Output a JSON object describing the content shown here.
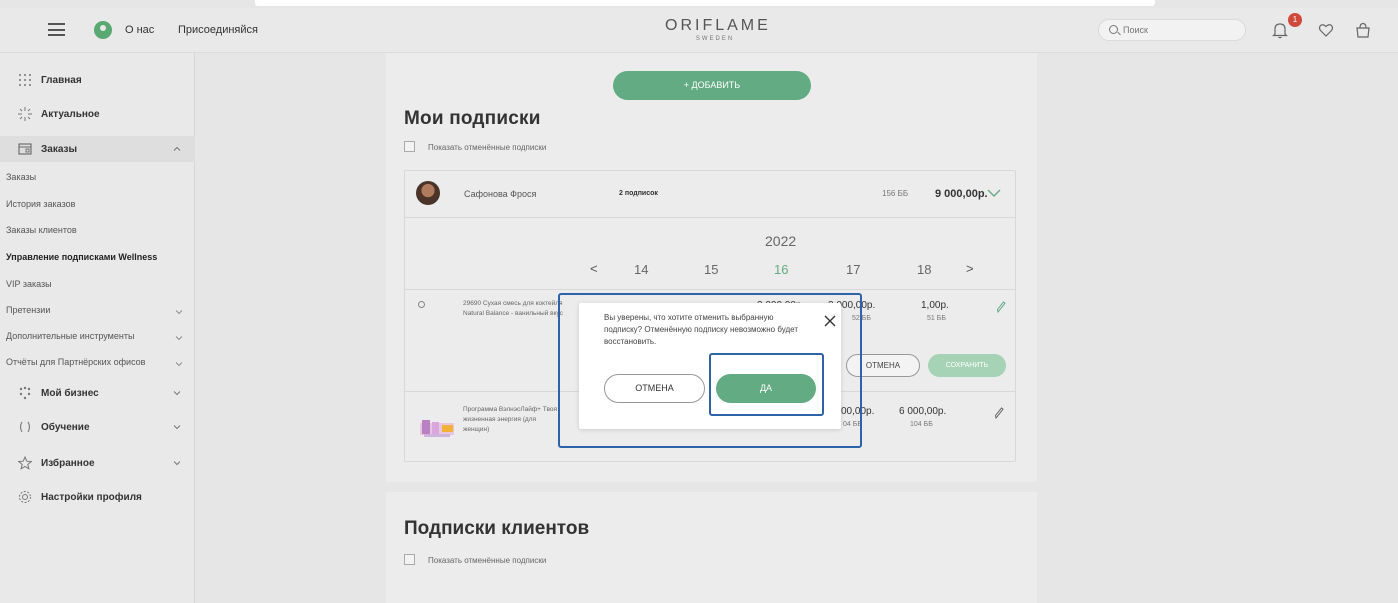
{
  "header": {
    "about_label": "О нас",
    "join_label": "Присоединяйся",
    "logo_main": "ORIFLAME",
    "logo_sub": "SWEDEN",
    "search_placeholder": "Поиск",
    "notification_count": "1"
  },
  "sidebar": {
    "home": "Главная",
    "news": "Актуальное",
    "orders": "Заказы",
    "orders_sub": {
      "orders": "Заказы",
      "history": "История заказов",
      "client_orders": "Заказы клиентов",
      "wellness": "Управление подписками Wellness",
      "vip": "VIP заказы",
      "claims": "Претензии",
      "tools": "Дополнительные инструменты",
      "reports": "Отчёты для Партнёрских офисов"
    },
    "business": "Мой бизнес",
    "learning": "Обучение",
    "favorites": "Избранное",
    "profile": "Настройки профиля"
  },
  "main": {
    "add_button": "+ ДОБАВИТЬ",
    "my_subs_title": "Мои подписки",
    "show_cancelled": "Показать отменённые подписки",
    "subscription": {
      "name": "Сафонова Фрося",
      "count": "2 подписок",
      "bb": "156 ББ",
      "total": "9 000,00р."
    },
    "year": "2022",
    "months": [
      "14",
      "15",
      "16",
      "17",
      "18"
    ],
    "product1": {
      "name": "29690 Сухая смесь для коктейля Natural Balance - ванильный вкус",
      "price1": "3 000,00р.",
      "price2": "3 000,00р.",
      "bb2": "52 ББ",
      "price3": "1,00р.",
      "bb3": "51 ББ"
    },
    "cancel_small": "ОТМЕНА",
    "save_small": "СОХРАНИТЬ",
    "product2": {
      "name": "Программа ВэлнэсЛайф+ Твоя жизненная энергия (для женщин)",
      "price1": "00,00р.",
      "bb1": "04 ББ",
      "price2": "6 000,00р.",
      "bb2": "104 ББ"
    },
    "client_subs_title": "Подписки клиентов",
    "show_cancelled_2": "Показать отменённые подписки"
  },
  "dialog": {
    "text": "Вы уверены, что хотите отменить выбранную подписку? Отменённую подписку невозможно будет восстановить.",
    "cancel": "ОТМЕНА",
    "yes": "ДА"
  },
  "colors": {
    "accent": "#63ab82",
    "highlight": "#2d63a8",
    "badge": "#d04a3c"
  }
}
